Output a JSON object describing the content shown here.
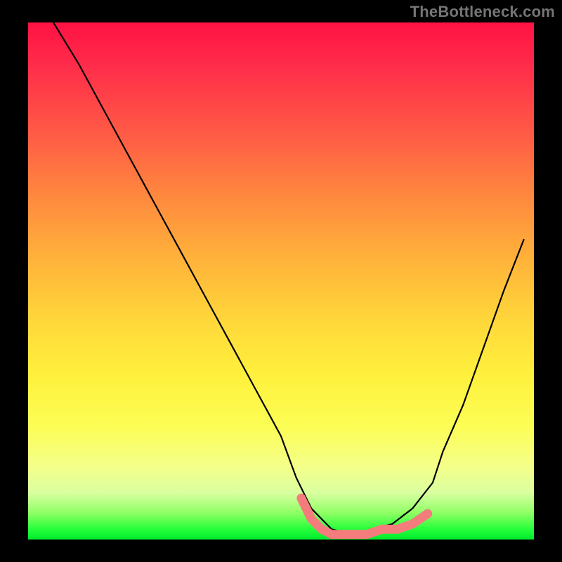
{
  "watermark": "TheBottleneck.com",
  "chart_data": {
    "type": "line",
    "title": "",
    "xlabel": "",
    "ylabel": "",
    "xlim": [
      0,
      100
    ],
    "ylim": [
      0,
      100
    ],
    "background_gradient": {
      "top_color_meaning": "high bottleneck (red)",
      "bottom_color_meaning": "no bottleneck (green)",
      "stops": [
        {
          "pos": 0,
          "color": "#ff1244"
        },
        {
          "pos": 50,
          "color": "#ffc43a"
        },
        {
          "pos": 85,
          "color": "#f4ff8a"
        },
        {
          "pos": 100,
          "color": "#00ea2e"
        }
      ]
    },
    "series": [
      {
        "name": "bottleneck-curve",
        "color": "#000000",
        "x": [
          5,
          10,
          15,
          20,
          25,
          30,
          35,
          40,
          45,
          50,
          53,
          56,
          60,
          64,
          68,
          72,
          76,
          80,
          82,
          86,
          90,
          94,
          98
        ],
        "values": [
          100,
          92,
          83,
          74,
          65,
          56,
          47,
          38,
          29,
          20,
          12,
          6,
          2,
          1,
          2,
          3,
          6,
          11,
          17,
          26,
          37,
          48,
          58
        ]
      },
      {
        "name": "optimal-flat-region",
        "color": "#f47c7c",
        "stroke_width": 8,
        "x": [
          54,
          56,
          58,
          60,
          62,
          64,
          67,
          70,
          73,
          76,
          79
        ],
        "values": [
          8,
          4,
          2,
          1,
          1,
          1,
          1,
          2,
          2,
          3,
          5
        ]
      }
    ],
    "markers": [
      {
        "name": "optimal-end-left",
        "x": 54,
        "y": 8,
        "color": "#f47c7c",
        "r": 4
      },
      {
        "name": "optimal-end-right",
        "x": 79,
        "y": 5,
        "color": "#f47c7c",
        "r": 4
      }
    ]
  }
}
